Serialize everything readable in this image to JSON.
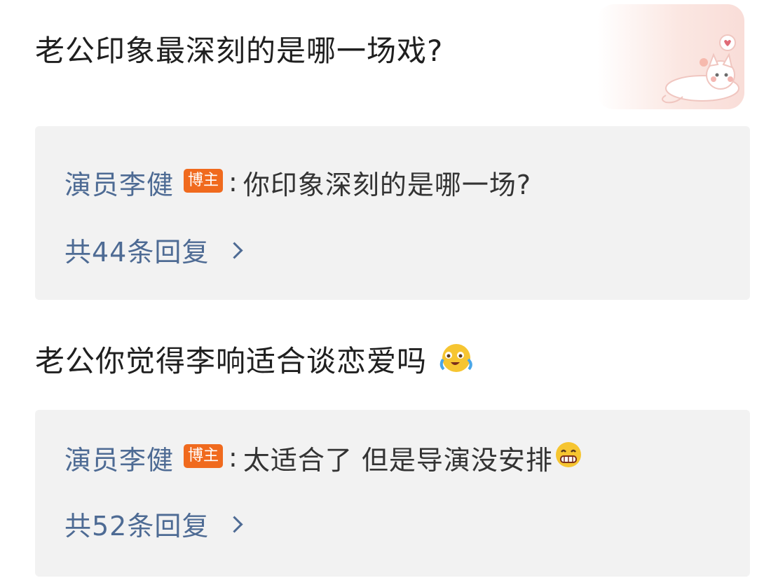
{
  "comments": [
    {
      "text": "老公印象最深刻的是哪一场戏?",
      "reply": {
        "author": "演员李健",
        "badge": "博主",
        "colon": ":",
        "text": "你印象深刻的是哪一场?",
        "count_label": "共44条回复"
      }
    },
    {
      "text": "老公你觉得李响适合谈恋爱吗",
      "text_emoji": "crying-laughing-emoji",
      "reply": {
        "author": "演员李健",
        "badge": "博主",
        "colon": ":",
        "text": "太适合了 但是导演没安排",
        "text_emoji": "grinning-emoji",
        "count_label": "共52条回复"
      }
    }
  ],
  "decoration": {
    "sticker": "cat-sticker-icon"
  },
  "colors": {
    "author": "#4e6b94",
    "badge": "#f06a1e",
    "reply_background": "#f2f2f2",
    "comment_text": "#1f1f1f"
  }
}
